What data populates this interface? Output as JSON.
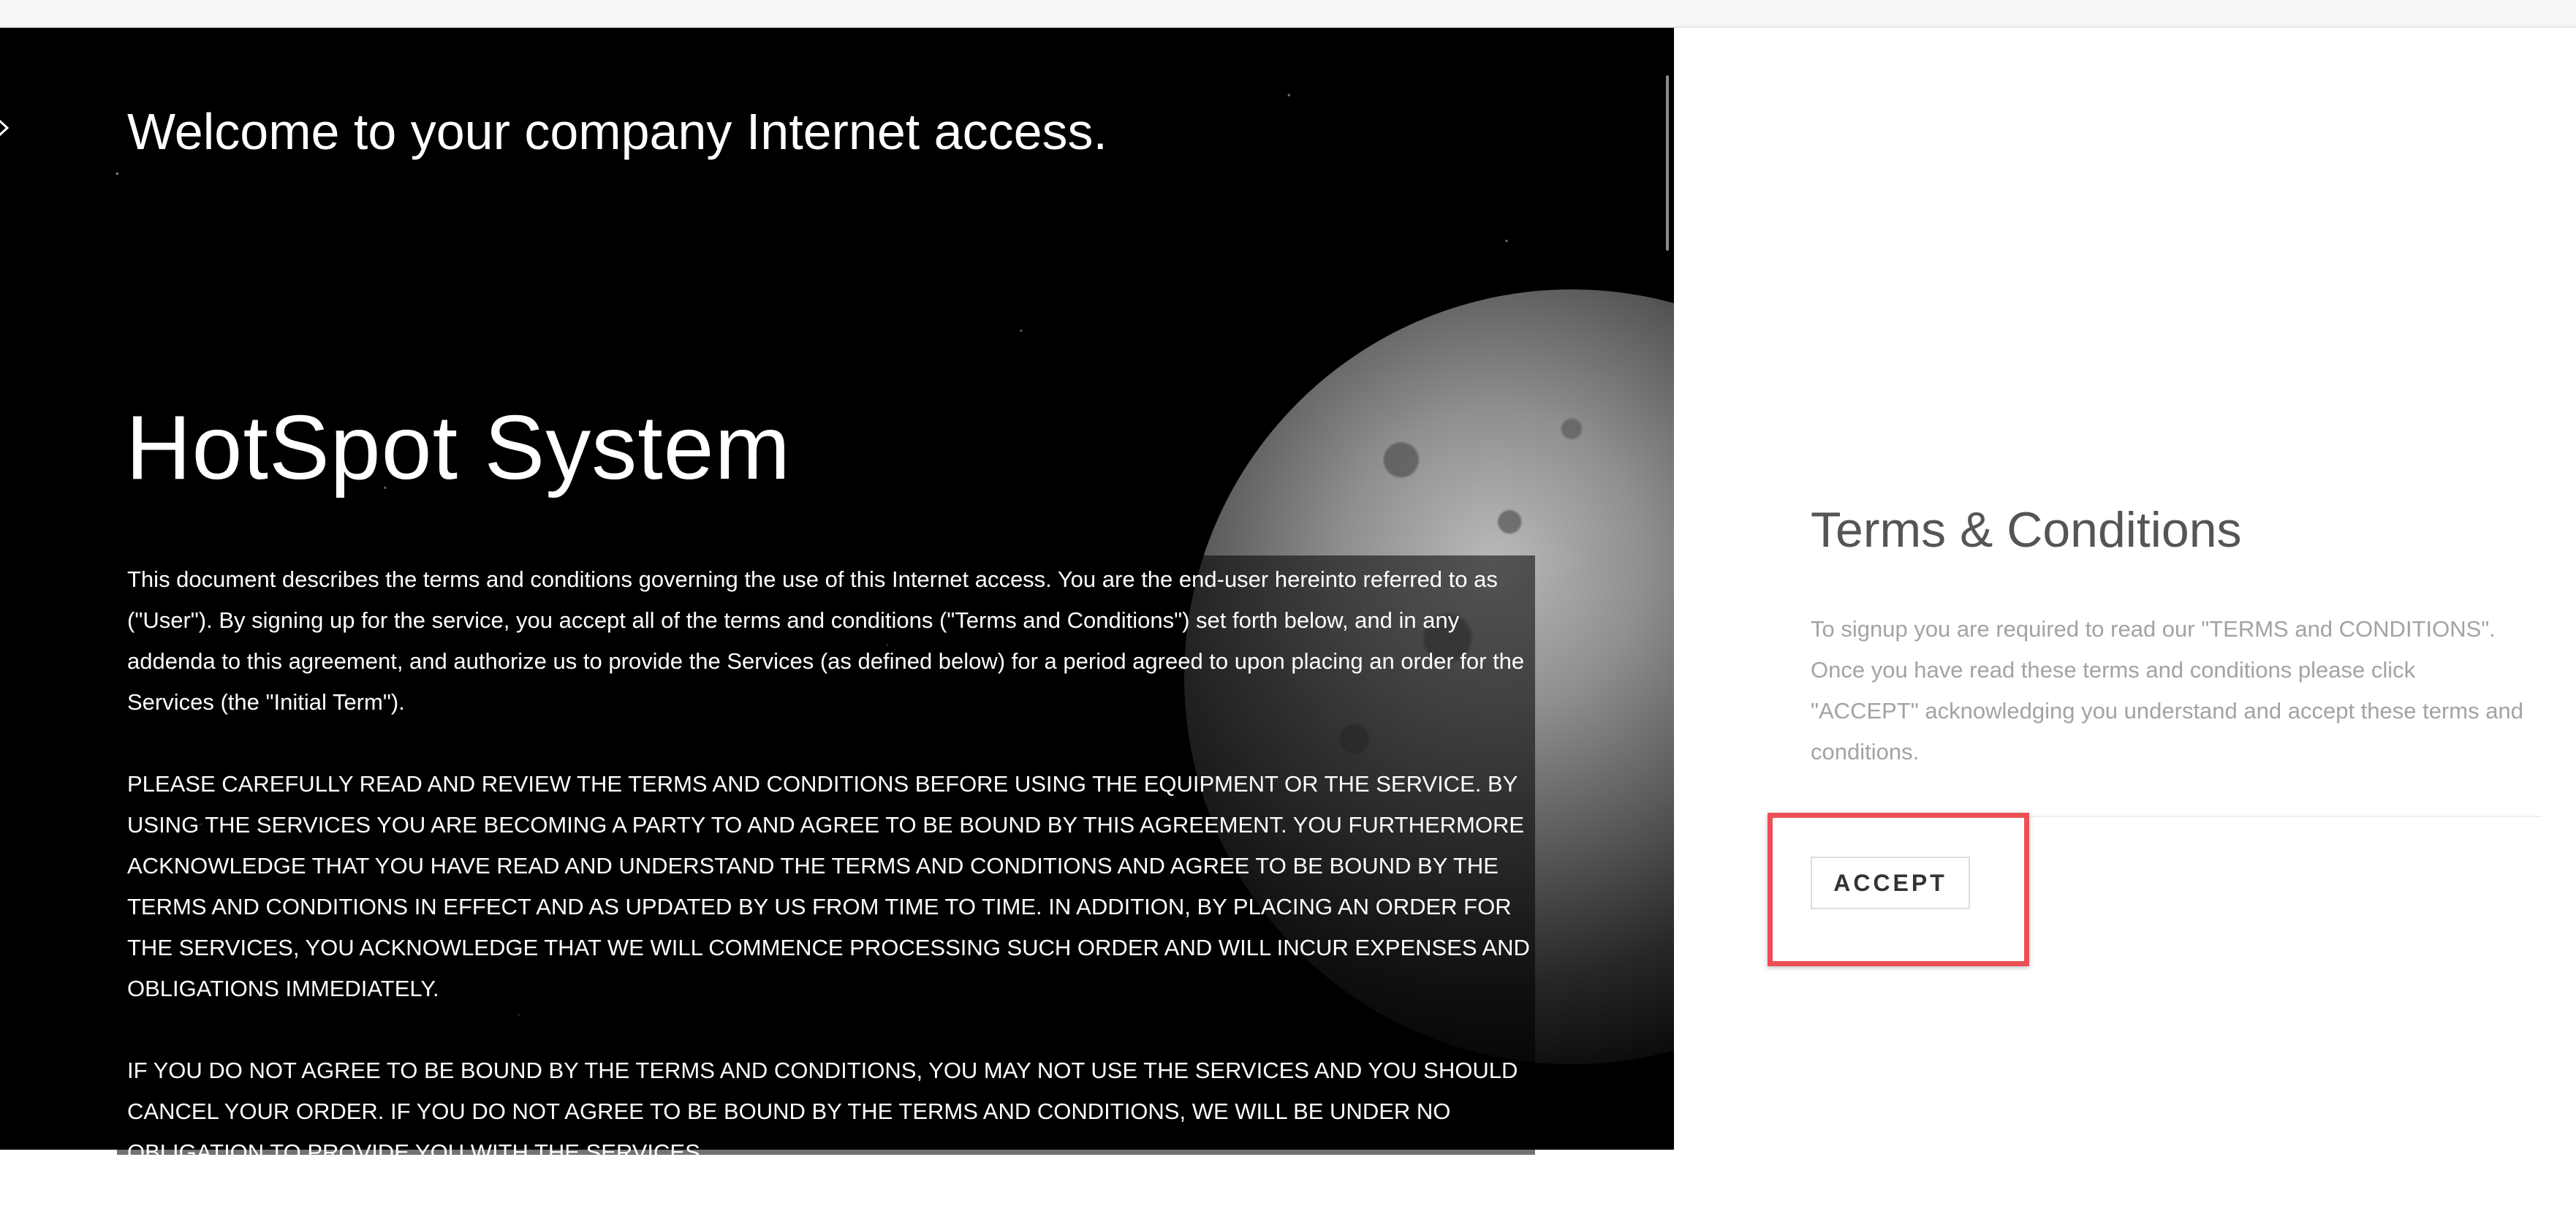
{
  "hero": {
    "welcome": "Welcome to your company Internet access.",
    "title": "HotSpot System",
    "paragraphs": [
      "This document describes the terms and conditions governing the use of this Internet access. You are the end-user hereinto referred to as (\"User\"). By signing up for the service, you accept all of the terms and conditions (\"Terms and Conditions\") set forth below, and in any addenda to this agreement, and authorize us to provide the Services (as defined below) for a period agreed to upon placing an order for the Services (the \"Initial Term\").",
      "PLEASE CAREFULLY READ AND REVIEW THE TERMS AND CONDITIONS BEFORE USING THE EQUIPMENT OR THE SERVICE. BY USING THE SERVICES YOU ARE BECOMING A PARTY TO AND AGREE TO BE BOUND BY THIS AGREEMENT. YOU FURTHERMORE ACKNOWLEDGE THAT YOU HAVE READ AND UNDERSTAND THE TERMS AND CONDITIONS AND AGREE TO BE BOUND BY THE TERMS AND CONDITIONS IN EFFECT AND AS UPDATED BY US FROM TIME TO TIME. IN ADDITION, BY PLACING AN ORDER FOR THE SERVICES, YOU ACKNOWLEDGE THAT WE WILL COMMENCE PROCESSING SUCH ORDER AND WILL INCUR EXPENSES AND OBLIGATIONS IMMEDIATELY.",
      "IF YOU DO NOT AGREE TO BE BOUND BY THE TERMS AND CONDITIONS, YOU MAY NOT USE THE SERVICES AND YOU SHOULD CANCEL YOUR ORDER. IF YOU DO NOT AGREE TO BE BOUND BY THE TERMS AND CONDITIONS, WE WILL BE UNDER NO OBLIGATION TO PROVIDE YOU WITH THE SERVICES."
    ]
  },
  "sidebar": {
    "title": "Terms & Conditions",
    "description": "To signup you are required to read our \"TERMS and CONDITIONS\". Once you have read these terms and conditions please click \"ACCEPT\" acknowledging you understand and accept these terms and conditions.",
    "accept_label": "ACCEPT"
  },
  "colors": {
    "highlight": "#ec4f56",
    "hero_background": "#000000",
    "panel_background": "#ffffff"
  },
  "icons": {
    "back": "back-arrow-icon"
  }
}
